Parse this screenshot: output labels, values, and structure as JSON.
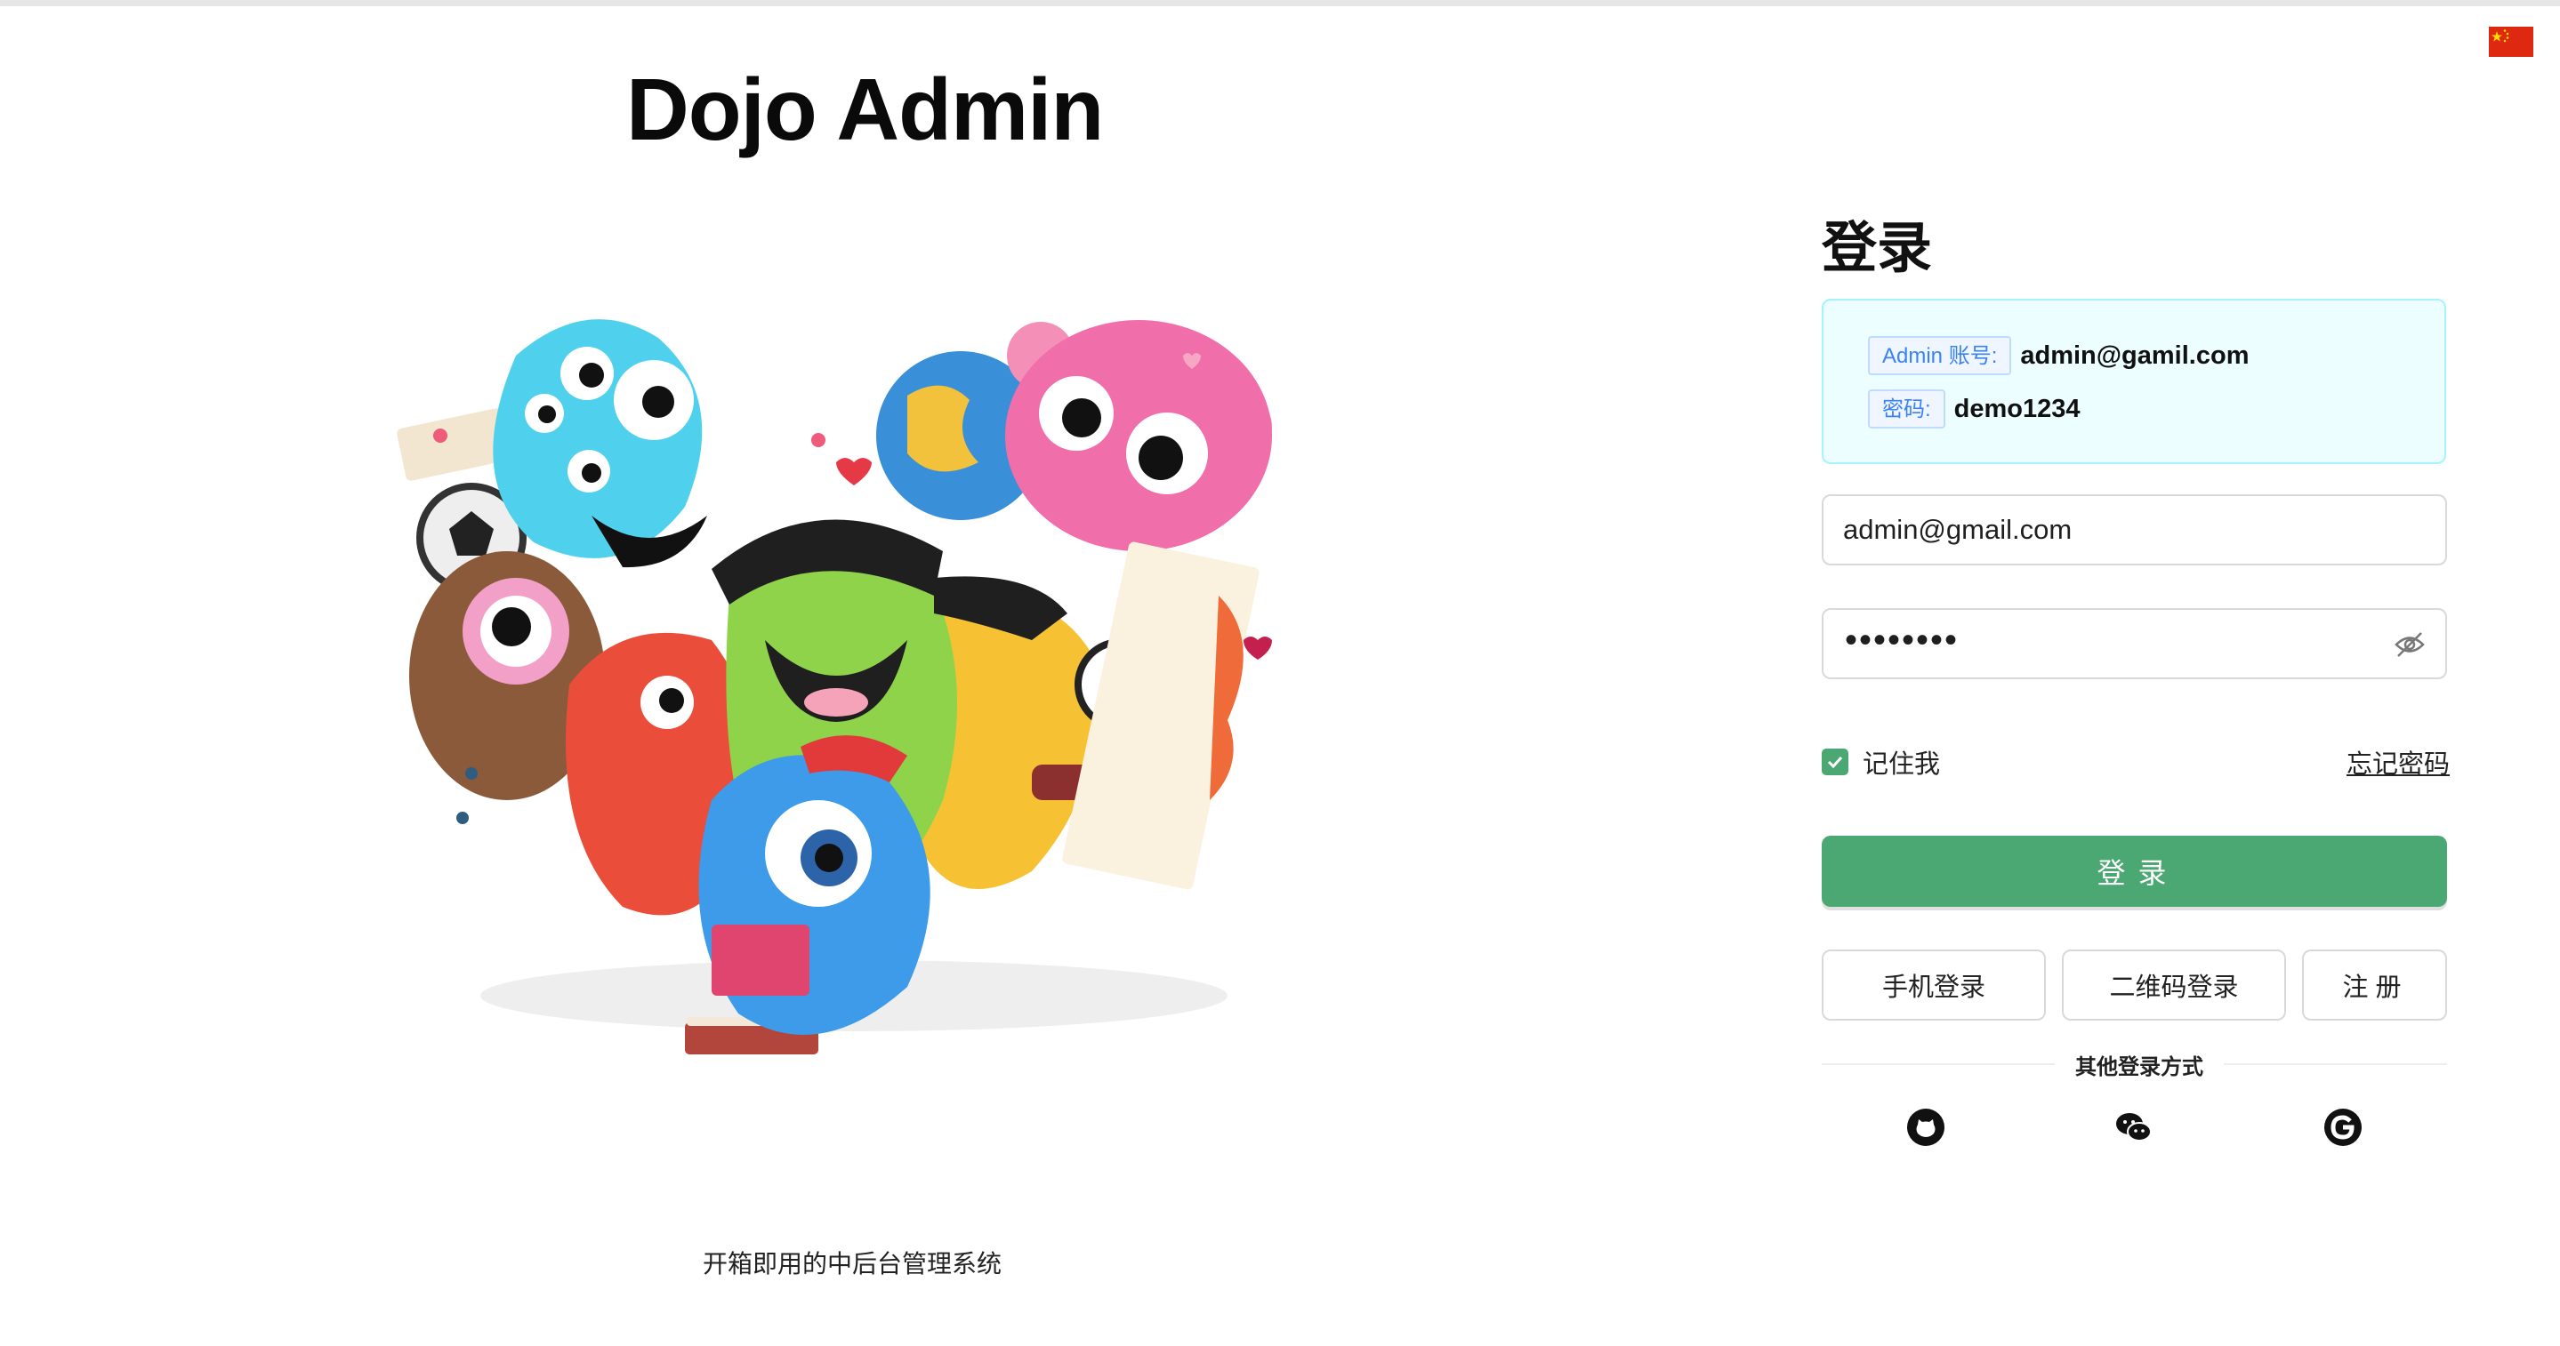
{
  "app": {
    "title": "Dojo Admin",
    "slogan": "开箱即用的中后台管理系统"
  },
  "language": {
    "current": "zh-CN",
    "icon": "china-flag-icon"
  },
  "login": {
    "title": "登录",
    "hint": {
      "account_tag": "Admin 账号:",
      "account_value": "admin@gamil.com",
      "password_tag": "密码:",
      "password_value": "demo1234"
    },
    "email_value": "admin@gmail.com",
    "password_masked": "••••••••",
    "password_icon": "eye-off-icon",
    "remember_label": "记住我",
    "remember_checked": true,
    "forgot_label": "忘记密码",
    "submit_label": "登录",
    "phone_login_label": "手机登录",
    "qr_login_label": "二维码登录",
    "register_label": "注册",
    "other_methods_label": "其他登录方式",
    "social": [
      "github-icon",
      "wechat-icon",
      "google-icon"
    ],
    "colors": {
      "primary": "#4ca873",
      "hint_bg": "#ecfeff",
      "hint_border": "#a5f3fc",
      "tag_text": "#3b82f6"
    }
  }
}
